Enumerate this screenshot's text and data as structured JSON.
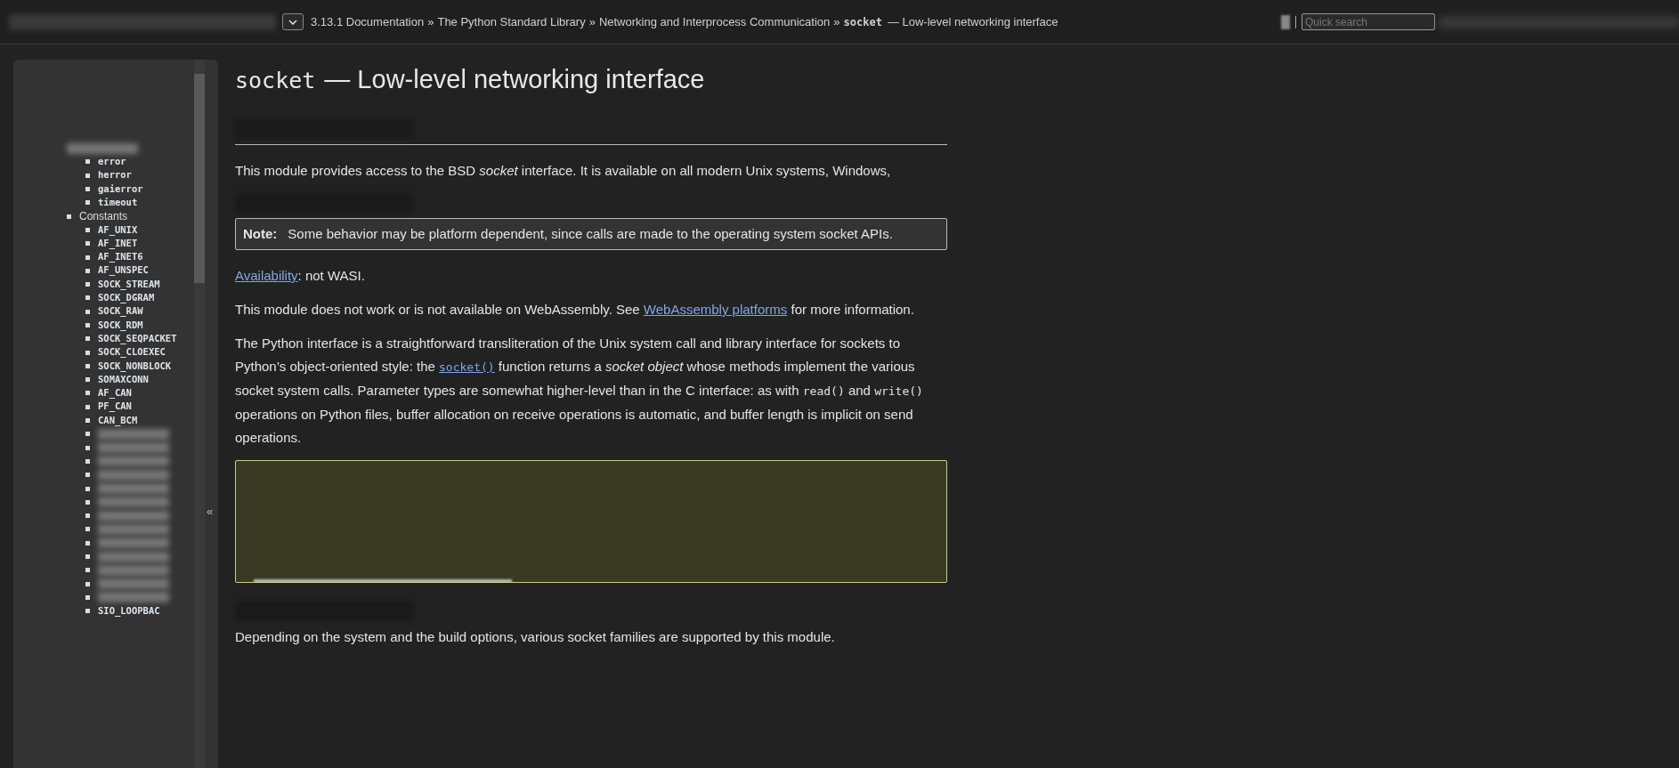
{
  "topbar": {
    "breadcrumb": [
      "3.13.1 Documentation",
      "The Python Standard Library",
      "Networking and Interprocess Communication"
    ],
    "separator": "»",
    "current": {
      "code": "socket",
      "text": "— Low-level networking interface"
    },
    "search": {
      "placeholder": "Quick search"
    }
  },
  "sidebar": {
    "collapse": "«",
    "items": [
      {
        "kind": "blurred",
        "children": [
          {
            "kind": "code",
            "label": "error"
          },
          {
            "kind": "code",
            "label": "herror"
          },
          {
            "kind": "code",
            "label": "gaierror"
          },
          {
            "kind": "code",
            "label": "timeout"
          }
        ]
      },
      {
        "kind": "text",
        "label": "Constants",
        "children": [
          {
            "kind": "code",
            "label": "AF_UNIX"
          },
          {
            "kind": "code",
            "label": "AF_INET"
          },
          {
            "kind": "code",
            "label": "AF_INET6"
          },
          {
            "kind": "code",
            "label": "AF_UNSPEC"
          },
          {
            "kind": "code",
            "label": "SOCK_STREAM"
          },
          {
            "kind": "code",
            "label": "SOCK_DGRAM"
          },
          {
            "kind": "code",
            "label": "SOCK_RAW"
          },
          {
            "kind": "code",
            "label": "SOCK_RDM"
          },
          {
            "kind": "code",
            "label": "SOCK_SEQPACKET"
          },
          {
            "kind": "code",
            "label": "SOCK_CLOEXEC"
          },
          {
            "kind": "code",
            "label": "SOCK_NONBLOCK"
          },
          {
            "kind": "code",
            "label": "SOMAXCONN"
          },
          {
            "kind": "code",
            "label": "AF_CAN"
          },
          {
            "kind": "code",
            "label": "PF_CAN"
          },
          {
            "kind": "code",
            "label": "CAN_BCM"
          },
          {
            "kind": "blurred"
          },
          {
            "kind": "blurred"
          },
          {
            "kind": "blurred"
          },
          {
            "kind": "blurred"
          },
          {
            "kind": "blurred"
          },
          {
            "kind": "blurred"
          },
          {
            "kind": "blurred"
          },
          {
            "kind": "blurred"
          },
          {
            "kind": "blurred"
          },
          {
            "kind": "blurred"
          },
          {
            "kind": "blurred"
          },
          {
            "kind": "blurred"
          },
          {
            "kind": "blurred"
          },
          {
            "kind": "code",
            "label": "SIO_LOOPBAC"
          }
        ]
      }
    ]
  },
  "main": {
    "title": {
      "code": "socket",
      "text": "— Low-level networking interface"
    },
    "blocks": [
      {
        "kind": "blurred_line"
      },
      {
        "kind": "rule"
      },
      {
        "kind": "para",
        "segments": [
          {
            "kind": "text",
            "text": "This module provides access to the BSD *socket* interface. It is available on all modern Unix systems, Windows,"
          }
        ]
      },
      {
        "kind": "blurred_line"
      },
      {
        "kind": "note",
        "label": "Note:",
        "text": "Some behavior may be platform dependent, since calls are made to the operating system socket APIs."
      },
      {
        "kind": "para",
        "segments": [
          {
            "kind": "link",
            "text": "Availability"
          },
          {
            "kind": "text",
            "text": ": not WASI."
          }
        ]
      },
      {
        "kind": "para",
        "segments": [
          {
            "kind": "text",
            "text": "This module does not work or is not available on WebAssembly. See "
          },
          {
            "kind": "link",
            "text": "WebAssembly platforms"
          },
          {
            "kind": "text",
            "text": " for more information."
          }
        ]
      },
      {
        "kind": "para",
        "segments": [
          {
            "kind": "text",
            "text": "The Python interface is a straightforward transliteration of the Unix system call and library interface for sockets to Python’s object-oriented style: the "
          },
          {
            "kind": "code_link",
            "text": "socket()"
          },
          {
            "kind": "text",
            "text": " function returns a *socket object* whose methods implement the various socket system calls. Parameter types are somewhat higher-level than in the C interface: as with "
          },
          {
            "kind": "code",
            "text": "read()"
          },
          {
            "kind": "text",
            "text": " and "
          },
          {
            "kind": "code",
            "text": "write()"
          },
          {
            "kind": "text",
            "text": " operations on Python files, buffer allocation on receive operations is automatic, and buffer length is implicit on send operations."
          }
        ]
      },
      {
        "kind": "blurred_box"
      },
      {
        "kind": "blurred_line"
      },
      {
        "kind": "para",
        "segments": [
          {
            "kind": "text",
            "text": "Depending on the system and the build options, various socket families are supported by this module."
          }
        ]
      }
    ]
  }
}
